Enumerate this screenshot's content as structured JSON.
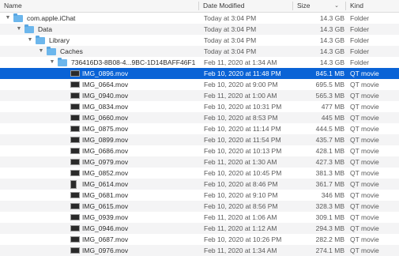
{
  "header": {
    "name": "Name",
    "date_modified": "Date Modified",
    "size": "Size",
    "kind": "Kind",
    "sort_indicator": "⌄"
  },
  "rows": [
    {
      "name": "com.apple.iChat",
      "date": "Today at 3:04 PM",
      "size": "14.3 GB",
      "kind": "Folder",
      "icon": "folder-icon",
      "expanded": true
    },
    {
      "name": "Data",
      "date": "Today at 3:04 PM",
      "size": "14.3 GB",
      "kind": "Folder",
      "icon": "folder-icon",
      "expanded": true
    },
    {
      "name": "Library",
      "date": "Today at 3:04 PM",
      "size": "14.3 GB",
      "kind": "Folder",
      "icon": "folder-icon",
      "expanded": true
    },
    {
      "name": "Caches",
      "date": "Today at 3:04 PM",
      "size": "14.3 GB",
      "kind": "Folder",
      "icon": "folder-icon",
      "expanded": true
    },
    {
      "name": "736416D3-8B08-4...9BC-1D14BAFF46F1",
      "date": "Feb 11, 2020 at 1:34 AM",
      "size": "14.3 GB",
      "kind": "Folder",
      "icon": "folder-icon",
      "expanded": true
    },
    {
      "name": "IMG_0896.mov",
      "date": "Feb 10, 2020 at 11:48 PM",
      "size": "845.1 MB",
      "kind": "QT movie",
      "icon": "video-file-icon",
      "selected": true
    },
    {
      "name": "IMG_0664.mov",
      "date": "Feb 10, 2020 at 9:00 PM",
      "size": "695.5 MB",
      "kind": "QT movie",
      "icon": "video-file-icon"
    },
    {
      "name": "IMG_0940.mov",
      "date": "Feb 11, 2020 at 1:00 AM",
      "size": "565.3 MB",
      "kind": "QT movie",
      "icon": "video-file-icon"
    },
    {
      "name": "IMG_0834.mov",
      "date": "Feb 10, 2020 at 10:31 PM",
      "size": "477 MB",
      "kind": "QT movie",
      "icon": "video-file-icon"
    },
    {
      "name": "IMG_0660.mov",
      "date": "Feb 10, 2020 at 8:53 PM",
      "size": "445 MB",
      "kind": "QT movie",
      "icon": "video-file-icon"
    },
    {
      "name": "IMG_0875.mov",
      "date": "Feb 10, 2020 at 11:14 PM",
      "size": "444.5 MB",
      "kind": "QT movie",
      "icon": "video-file-icon"
    },
    {
      "name": "IMG_0899.mov",
      "date": "Feb 10, 2020 at 11:54 PM",
      "size": "435.7 MB",
      "kind": "QT movie",
      "icon": "video-file-icon"
    },
    {
      "name": "IMG_0686.mov",
      "date": "Feb 10, 2020 at 10:13 PM",
      "size": "428.1 MB",
      "kind": "QT movie",
      "icon": "video-file-icon"
    },
    {
      "name": "IMG_0979.mov",
      "date": "Feb 11, 2020 at 1:30 AM",
      "size": "427.3 MB",
      "kind": "QT movie",
      "icon": "video-file-icon"
    },
    {
      "name": "IMG_0852.mov",
      "date": "Feb 10, 2020 at 10:45 PM",
      "size": "381.3 MB",
      "kind": "QT movie",
      "icon": "video-file-icon"
    },
    {
      "name": "IMG_0614.mov",
      "date": "Feb 10, 2020 at 8:46 PM",
      "size": "361.7 MB",
      "kind": "QT movie",
      "icon": "video-file-icon"
    },
    {
      "name": "IMG_0681.mov",
      "date": "Feb 10, 2020 at 9:10 PM",
      "size": "346 MB",
      "kind": "QT movie",
      "icon": "video-file-icon"
    },
    {
      "name": "IMG_0615.mov",
      "date": "Feb 10, 2020 at 8:56 PM",
      "size": "328.3 MB",
      "kind": "QT movie",
      "icon": "video-file-icon"
    },
    {
      "name": "IMG_0939.mov",
      "date": "Feb 11, 2020 at 1:06 AM",
      "size": "309.1 MB",
      "kind": "QT movie",
      "icon": "video-file-icon"
    },
    {
      "name": "IMG_0946.mov",
      "date": "Feb 11, 2020 at 1:12 AM",
      "size": "294.3 MB",
      "kind": "QT movie",
      "icon": "video-file-icon"
    },
    {
      "name": "IMG_0687.mov",
      "date": "Feb 10, 2020 at 10:26 PM",
      "size": "282.2 MB",
      "kind": "QT movie",
      "icon": "video-file-icon"
    },
    {
      "name": "IMG_0976.mov",
      "date": "Feb 11, 2020 at 1:34 AM",
      "size": "274.1 MB",
      "kind": "QT movie",
      "icon": "video-file-icon"
    }
  ]
}
